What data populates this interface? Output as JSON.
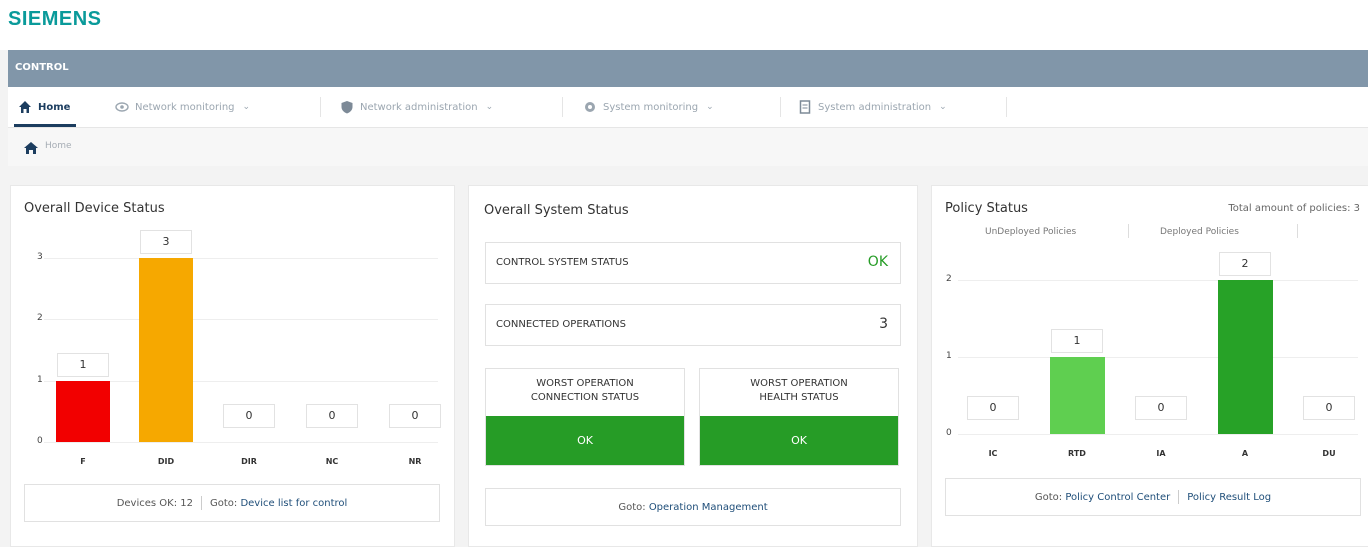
{
  "brand": {
    "logo": "SIEMENS"
  },
  "app": {
    "title": "CONTROL"
  },
  "nav": {
    "items": [
      {
        "label": "Home",
        "icon": "home-icon"
      },
      {
        "label": "Network monitoring",
        "icon": "eye-icon"
      },
      {
        "label": "Network administration",
        "icon": "shield-icon"
      },
      {
        "label": "System monitoring",
        "icon": "gear-icon"
      },
      {
        "label": "System administration",
        "icon": "document-icon"
      }
    ]
  },
  "breadcrumb": {
    "home": "Home"
  },
  "device_status": {
    "title": "Overall Device Status",
    "yticks": [
      "3",
      "2",
      "1",
      "0"
    ],
    "footer_devices_ok": "Devices OK: 12",
    "footer_goto": "Goto:",
    "footer_link": "Device list for control"
  },
  "system_status": {
    "title": "Overall System Status",
    "control_label": "CONTROL SYSTEM STATUS",
    "control_value": "OK",
    "connected_label": "CONNECTED OPERATIONS",
    "connected_value": "3",
    "worst_conn_label": "WORST OPERATION CONNECTION STATUS",
    "worst_conn_value": "OK",
    "worst_health_label": "WORST OPERATION HEALTH STATUS",
    "worst_health_value": "OK",
    "footer_goto": "Goto:",
    "footer_link": "Operation Management"
  },
  "policy_status": {
    "title": "Policy Status",
    "total_text": "Total amount of policies: 3",
    "legend_undeployed": "UnDeployed Policies",
    "legend_deployed": "Deployed Policies",
    "yticks": [
      "2",
      "1",
      "0"
    ],
    "footer_goto": "Goto:",
    "footer_link1": "Policy Control Center",
    "footer_link2": "Policy Result Log"
  },
  "chart_data": [
    {
      "type": "bar",
      "title": "Overall Device Status",
      "categories": [
        "F",
        "DID",
        "DIR",
        "NC",
        "NR"
      ],
      "values": [
        1,
        3,
        0,
        0,
        0
      ],
      "ylim": [
        0,
        3
      ],
      "colors": [
        "#f20000",
        "#f6a800",
        "#cccccc",
        "#cccccc",
        "#cccccc"
      ]
    },
    {
      "type": "bar",
      "title": "Policy Status",
      "categories": [
        "IC",
        "RTD",
        "IA",
        "A",
        "DU"
      ],
      "values": [
        0,
        1,
        0,
        2,
        0
      ],
      "ylim": [
        0,
        2
      ],
      "colors": [
        "#cccccc",
        "#5fcf50",
        "#cccccc",
        "#27a227",
        "#cccccc"
      ]
    }
  ],
  "colors": {
    "brand": "#0a9a9a",
    "appbar": "#8196a9",
    "ok_green": "#269c26",
    "nav_active": "#1c3d5f"
  }
}
